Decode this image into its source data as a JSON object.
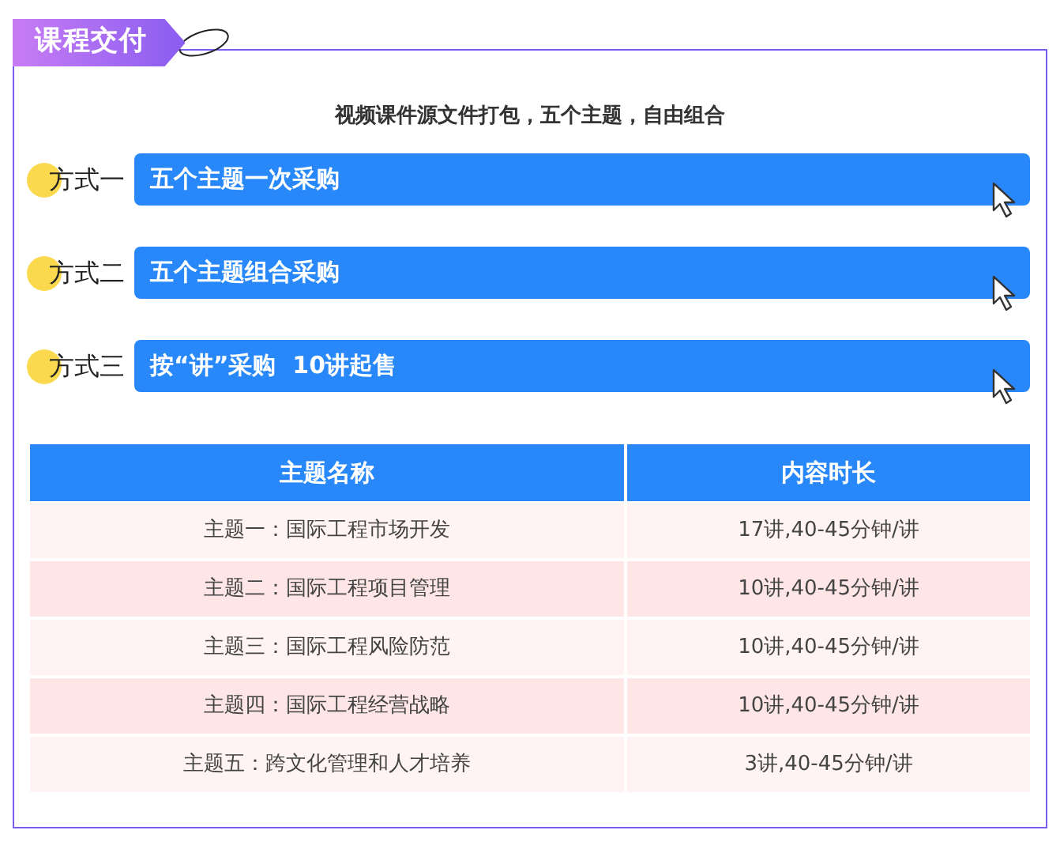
{
  "tag": {
    "title": "课程交付"
  },
  "subtitle": "视频课件源文件打包，五个主题，自由组合",
  "options": [
    {
      "label": "方式一",
      "text": "五个主题一次采购"
    },
    {
      "label": "方式二",
      "text": "五个主题组合采购"
    },
    {
      "label": "方式三",
      "text": "按“讲”采购  10讲起售"
    }
  ],
  "table": {
    "columns": [
      "主题名称",
      "内容时长"
    ],
    "rows": [
      [
        "主题一：国际工程市场开发",
        "17讲,40-45分钟/讲"
      ],
      [
        "主题二：国际工程项目管理",
        "10讲,40-45分钟/讲"
      ],
      [
        "主题三：国际工程风险防范",
        "10讲,40-45分钟/讲"
      ],
      [
        "主题四：国际工程经营战略",
        "10讲,40-45分钟/讲"
      ],
      [
        "主题五：跨文化管理和人才培养",
        "3讲,40-45分钟/讲"
      ]
    ]
  }
}
